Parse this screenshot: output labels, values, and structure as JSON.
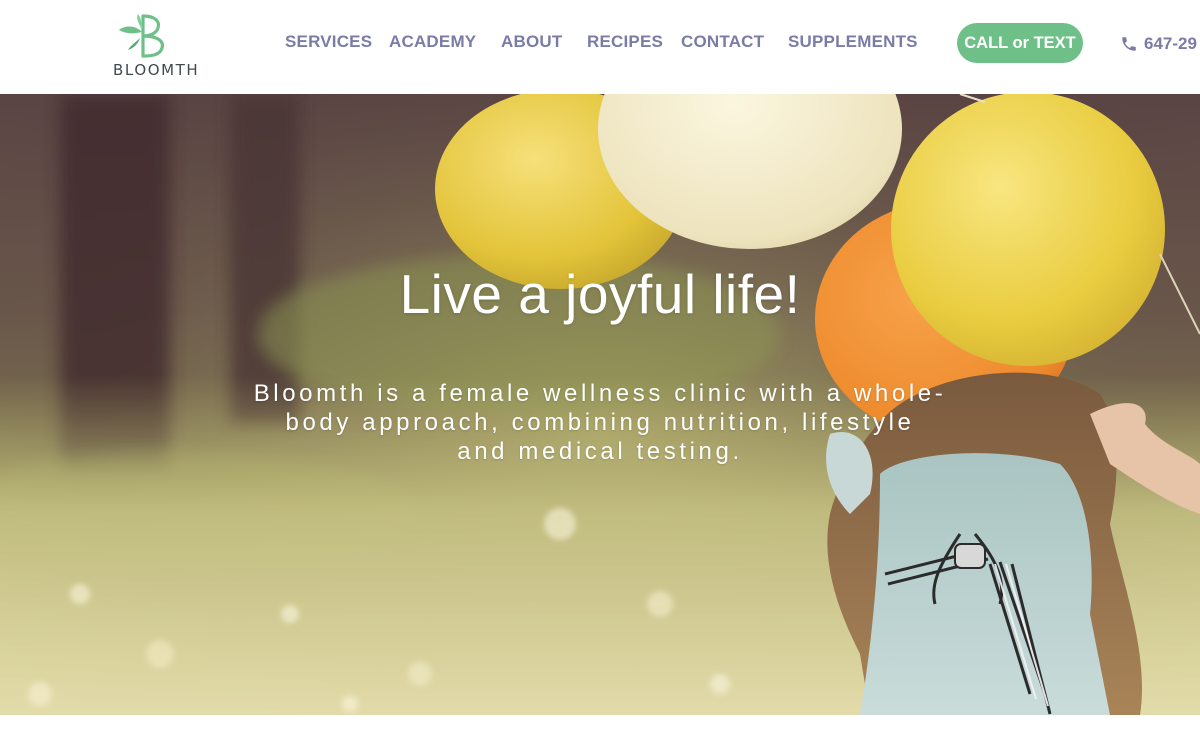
{
  "brand": {
    "name": "BLOOMTH",
    "logo_icon": "b-leaf-logo-icon",
    "logo_color": "#6fc088"
  },
  "nav": {
    "items": [
      {
        "label": "SERVICES"
      },
      {
        "label": "ACADEMY"
      },
      {
        "label": "ABOUT"
      },
      {
        "label": "RECIPES"
      },
      {
        "label": "CONTACT"
      },
      {
        "label": "SUPPLEMENTS"
      }
    ],
    "color": "#7a7ca6"
  },
  "cta": {
    "label": "CALL or TEXT",
    "color": "#6fc088"
  },
  "phone": {
    "icon": "phone-icon",
    "number": "647-29"
  },
  "hero": {
    "title": "Live a joyful life!",
    "subtitle_lines": [
      "Bloomth is a female wellness clinic with a whole-",
      "body approach, combining nutrition, lifestyle",
      "and medical testing."
    ],
    "image_description_icon": "girl-with-balloons-photo"
  }
}
